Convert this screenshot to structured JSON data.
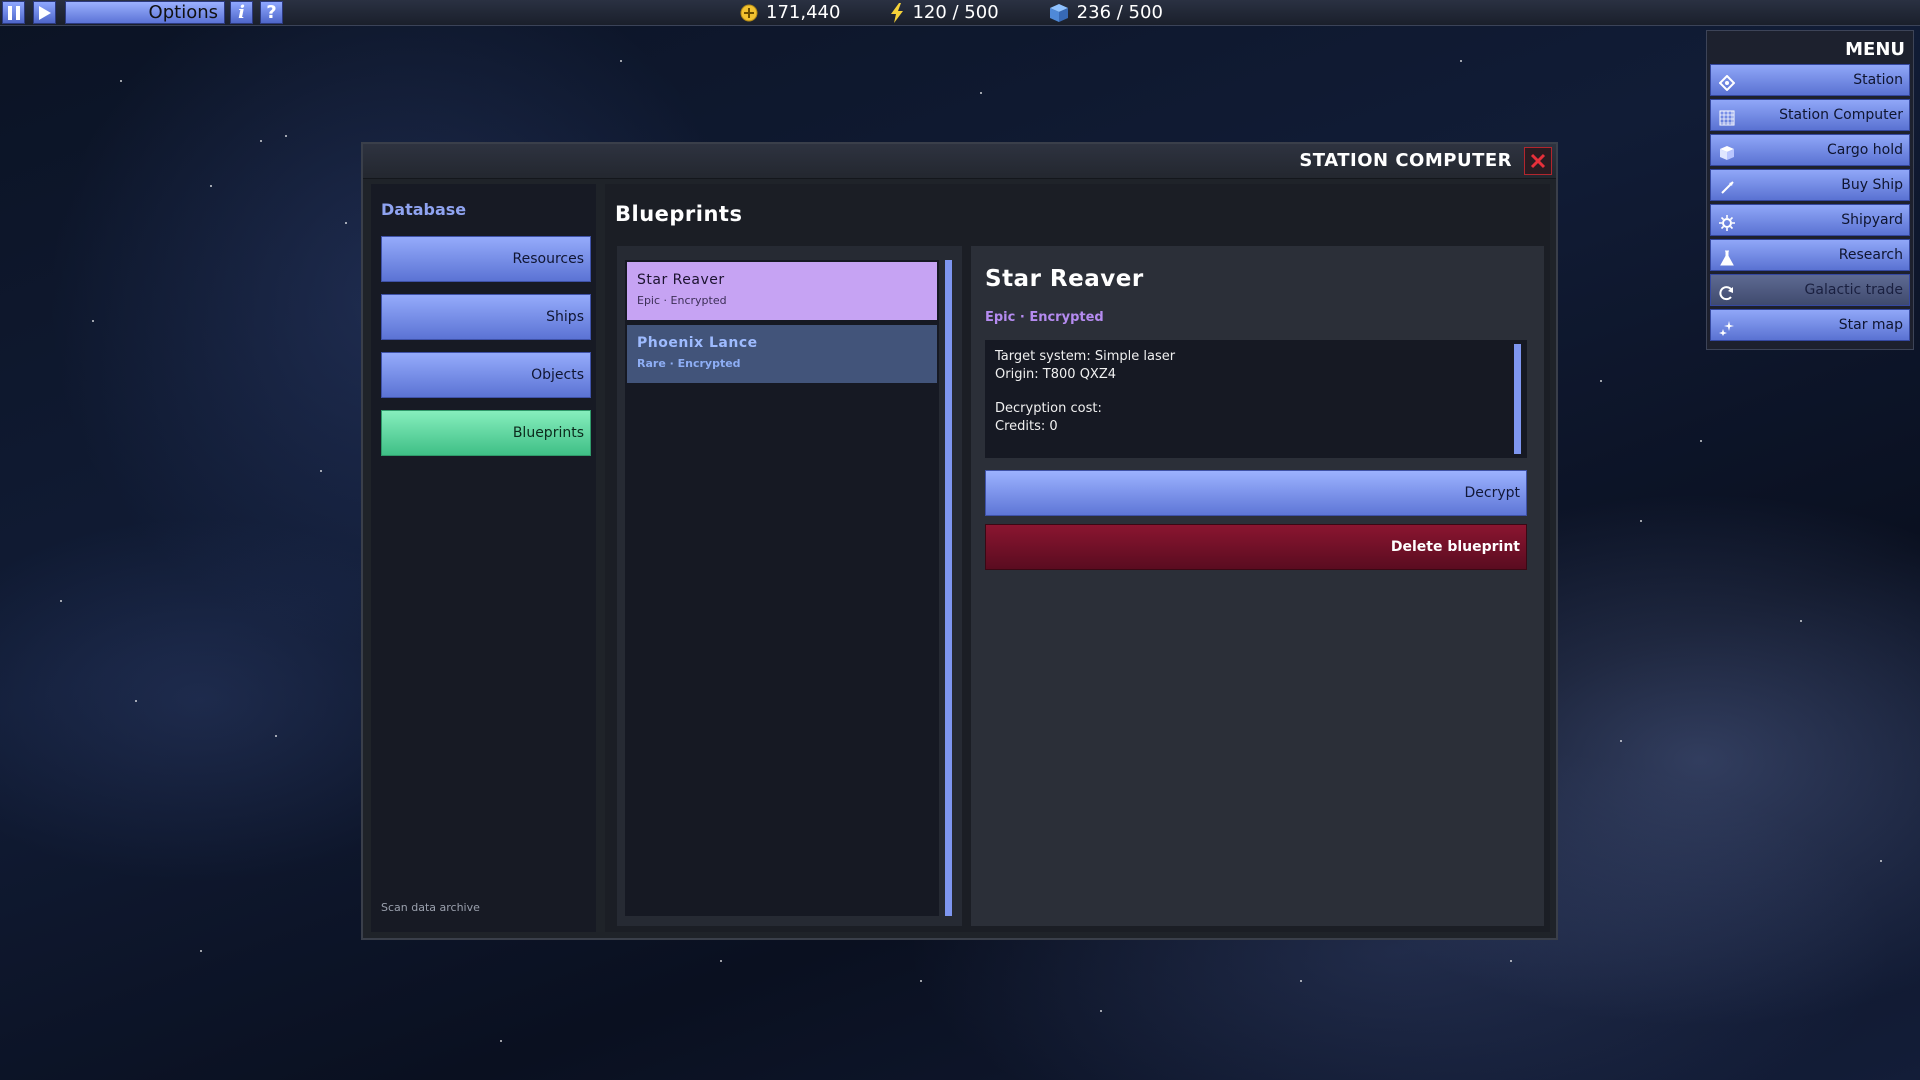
{
  "topbar": {
    "options_label": "Options",
    "info_label": "i",
    "help_label": "?",
    "credits": "171,440",
    "energy": "120 / 500",
    "cargo": "236 / 500"
  },
  "menu": {
    "title": "MENU",
    "items": [
      {
        "label": "Station",
        "icon": "diamond-icon"
      },
      {
        "label": "Station Computer",
        "icon": "grid-icon"
      },
      {
        "label": "Cargo hold",
        "icon": "cube-icon"
      },
      {
        "label": "Buy Ship",
        "icon": "rocket-icon"
      },
      {
        "label": "Shipyard",
        "icon": "gear-icon"
      },
      {
        "label": "Research",
        "icon": "flask-icon"
      },
      {
        "label": "Galactic trade",
        "icon": "exchange-icon"
      },
      {
        "label": "Star map",
        "icon": "stars-icon"
      }
    ]
  },
  "window": {
    "title": "STATION COMPUTER"
  },
  "sidebar": {
    "heading": "Database",
    "buttons": [
      "Resources",
      "Ships",
      "Objects",
      "Blueprints"
    ],
    "active": "Blueprints",
    "footer": "Scan data archive"
  },
  "blueprints": {
    "heading": "Blueprints",
    "items": [
      {
        "name": "Star Reaver",
        "sub": "Epic · Encrypted"
      },
      {
        "name": "Phoenix Lance",
        "sub": "Rare · Encrypted"
      }
    ]
  },
  "detail": {
    "name": "Star Reaver",
    "rarity": "Epic · Encrypted",
    "line1": "Target system: Simple laser",
    "line2": "Origin: T800 QXZ4",
    "line3": "Decryption cost:",
    "line4": "Credits: 0",
    "decrypt_label": "Decrypt",
    "delete_label": "Delete blueprint"
  },
  "colors": {
    "accent_blue": "#7e96f0",
    "active_green": "#5fd9a0",
    "epic_purple": "#c6a3f3",
    "danger_red": "#7a1228"
  }
}
